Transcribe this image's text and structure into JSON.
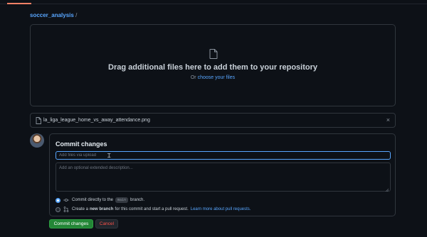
{
  "breadcrumb": {
    "repo": "soccer_analysis",
    "separator": "/"
  },
  "dropzone": {
    "title": "Drag additional files here to add them to your repository",
    "prefix": "Or",
    "choose_link": "choose your files",
    "icon": "file-icon"
  },
  "uploaded_file": {
    "name": "la_liga_league_home_vs_away_attendance.png",
    "remove": "×"
  },
  "commit": {
    "heading": "Commit changes",
    "summary_value": "",
    "summary_placeholder": "Add files via upload",
    "description_placeholder": "Add an optional extended description...",
    "option_direct": {
      "before": "Commit directly to the",
      "branch": "main",
      "after": "branch.",
      "selected": true
    },
    "option_pr": {
      "before": "Create a",
      "bold": "new branch",
      "after": "for this commit and start a pull request.",
      "link": "Learn more about pull requests.",
      "selected": false
    }
  },
  "buttons": {
    "commit": "Commit changes",
    "cancel": "Cancel"
  },
  "colors": {
    "background": "#0d1117",
    "accent_link": "#58a6ff",
    "commit_button": "#238636",
    "cancel_text": "#f85149",
    "tab_underline": "#f78166"
  }
}
